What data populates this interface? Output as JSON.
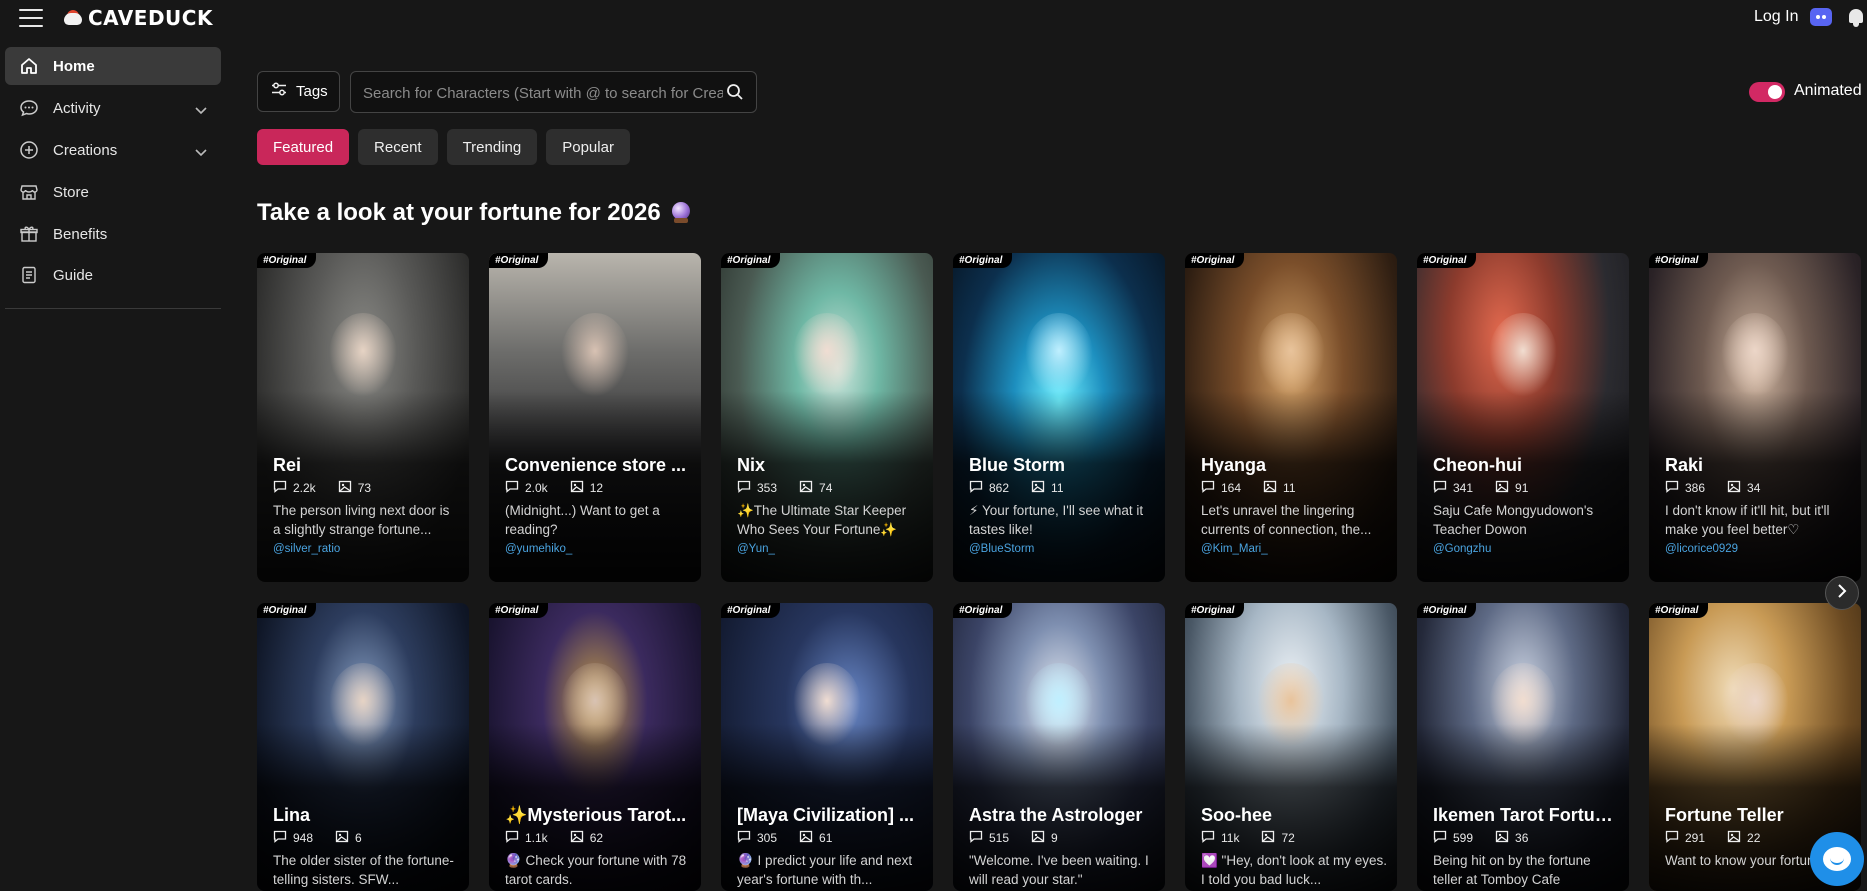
{
  "brand": {
    "name": "CAVEDUCK"
  },
  "header": {
    "login_label": "Log In"
  },
  "sidebar": {
    "items": [
      {
        "label": "Home",
        "icon": "home-icon",
        "active": true
      },
      {
        "label": "Activity",
        "icon": "chat-bubble-icon",
        "expandable": true
      },
      {
        "label": "Creations",
        "icon": "plus-circle-icon",
        "expandable": true
      },
      {
        "label": "Store",
        "icon": "store-icon"
      },
      {
        "label": "Benefits",
        "icon": "gift-icon"
      },
      {
        "label": "Guide",
        "icon": "document-icon"
      }
    ]
  },
  "toolbar": {
    "tags_label": "Tags",
    "search_placeholder": "Search for Characters (Start with @ to search for Creators)",
    "animated_label": "Animated",
    "animated_on": true
  },
  "filters": [
    "Featured",
    "Recent",
    "Trending",
    "Popular"
  ],
  "section": {
    "title": "Take a look at your fortune for 2026"
  },
  "tag_label": "#Original",
  "row1": [
    {
      "name": "Rei",
      "chats": "2.2k",
      "images": "73",
      "desc": "The person living next door is a slightly strange fortune...",
      "author": "@silver_ratio"
    },
    {
      "name": "Convenience store ...",
      "chats": "2.0k",
      "images": "12",
      "desc": "(Midnight...) Want to get a reading?",
      "author": "@yumehiko_"
    },
    {
      "name": "Nix",
      "chats": "353",
      "images": "74",
      "desc": "✨The Ultimate Star Keeper Who Sees Your Fortune✨",
      "author": "@Yun_"
    },
    {
      "name": "Blue Storm",
      "chats": "862",
      "images": "11",
      "desc": "⚡ Your fortune, I'll see what it tastes like!",
      "author": "@BlueStorm"
    },
    {
      "name": "Hyanga",
      "chats": "164",
      "images": "11",
      "desc": "Let's unravel the lingering currents of connection, the...",
      "author": "@Kim_Mari_"
    },
    {
      "name": "Cheon-hui",
      "chats": "341",
      "images": "91",
      "desc": "Saju Cafe Mongyudowon's Teacher Dowon",
      "author": "@Gongzhu"
    },
    {
      "name": "Raki",
      "chats": "386",
      "images": "34",
      "desc": "I don't know if it'll hit, but it'll make you feel better♡",
      "author": "@licorice0929"
    }
  ],
  "row2": [
    {
      "name": "Lina",
      "chats": "948",
      "images": "6",
      "desc": "The older sister of the fortune-telling sisters. SFW..."
    },
    {
      "name": "✨Mysterious Tarot...",
      "chats": "1.1k",
      "images": "62",
      "desc": "🔮 Check your fortune with 78 tarot cards."
    },
    {
      "name": "[Maya Civilization] ...",
      "chats": "305",
      "images": "61",
      "desc": "🔮 I predict your life and next year's fortune with th..."
    },
    {
      "name": "Astra the Astrologer",
      "chats": "515",
      "images": "9",
      "desc": "\"Welcome. I've been waiting. I will read your star.\""
    },
    {
      "name": "Soo-hee",
      "chats": "11k",
      "images": "72",
      "desc": "💟 \"Hey, don't look at my eyes. I told you bad luck..."
    },
    {
      "name": "Ikemen Tarot Fortun...",
      "chats": "599",
      "images": "36",
      "desc": "Being hit on by the fortune teller at Tomboy Cafe"
    },
    {
      "name": "Fortune Teller",
      "chats": "291",
      "images": "22",
      "desc": "Want to know your fortune?"
    }
  ],
  "colors": {
    "accent": "#c9275a",
    "author_link": "#4aa3df",
    "background": "#171717",
    "chat_fab": "#1f8fe8"
  }
}
